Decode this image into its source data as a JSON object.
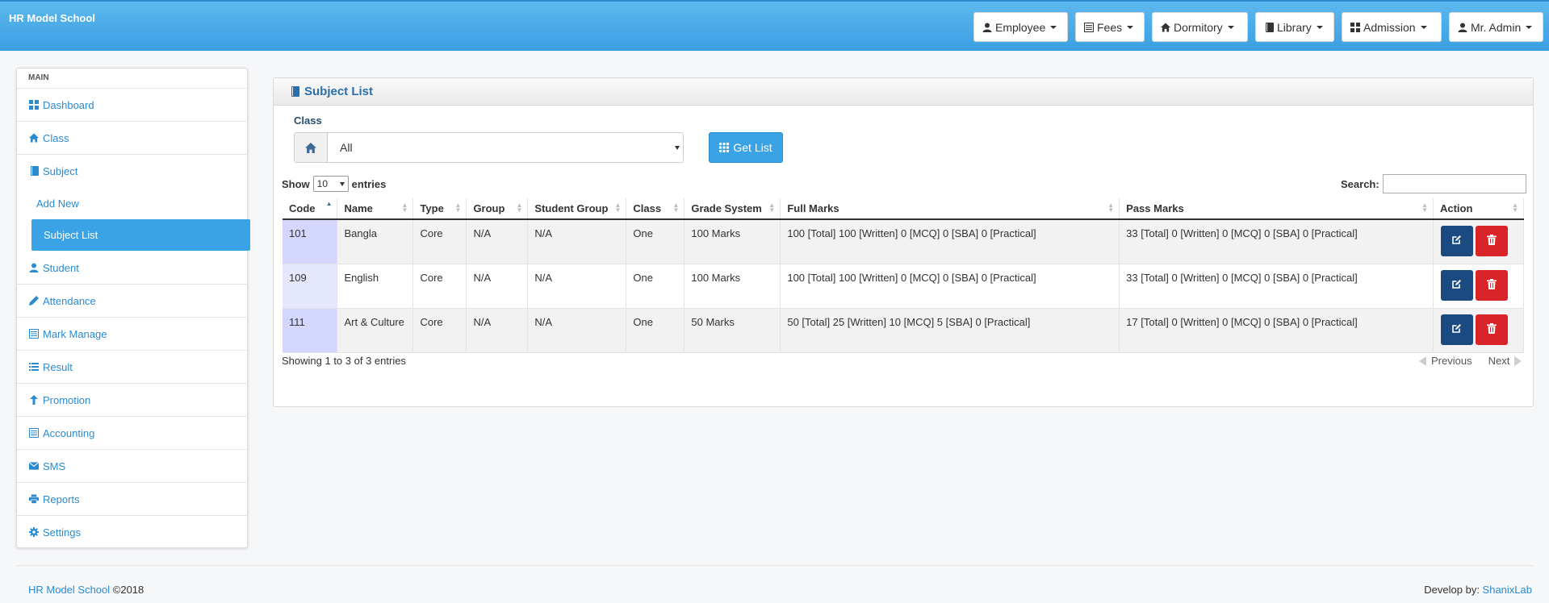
{
  "app": {
    "title": "HR Model School"
  },
  "nav": {
    "employee": "Employee",
    "fees": "Fees",
    "dormitory": "Dormitory",
    "library": "Library",
    "admission": "Admission",
    "user": "Mr. Admin"
  },
  "sidebar": {
    "header": "MAIN",
    "dashboard": "Dashboard",
    "class": "Class",
    "subject": "Subject",
    "add_new": "Add New",
    "subject_list": "Subject List",
    "student": "Student",
    "attendance": "Attendance",
    "mark_manage": "Mark Manage",
    "result": "Result",
    "promotion": "Promotion",
    "accounting": "Accounting",
    "sms": "SMS",
    "reports": "Reports",
    "settings": "Settings"
  },
  "panel": {
    "title": "Subject List",
    "class_label": "Class",
    "class_value": "All",
    "get_list": "Get List",
    "show_label": "Show",
    "show_value": "10",
    "entries_label": "entries",
    "search_label": "Search:"
  },
  "table": {
    "headers": [
      "Code",
      "Name",
      "Type",
      "Group",
      "Student Group",
      "Class",
      "Grade System",
      "Full Marks",
      "Pass Marks",
      "Action"
    ],
    "rows": [
      {
        "code": "101",
        "name": "Bangla",
        "type": "Core",
        "group": "N/A",
        "student_group": "N/A",
        "class": "One",
        "grade": "100 Marks",
        "full": "100 [Total] 100 [Written] 0 [MCQ] 0 [SBA] 0 [Practical]",
        "pass": "33 [Total] 0 [Written] 0 [MCQ] 0 [SBA] 0 [Practical]"
      },
      {
        "code": "109",
        "name": "English",
        "type": "Core",
        "group": "N/A",
        "student_group": "N/A",
        "class": "One",
        "grade": "100 Marks",
        "full": "100 [Total] 100 [Written] 0 [MCQ] 0 [SBA] 0 [Practical]",
        "pass": "33 [Total] 0 [Written] 0 [MCQ] 0 [SBA] 0 [Practical]"
      },
      {
        "code": "111",
        "name": "Art & Culture",
        "type": "Core",
        "group": "N/A",
        "student_group": "N/A",
        "class": "One",
        "grade": "50 Marks",
        "full": "50 [Total] 25 [Written] 10 [MCQ] 5 [SBA] 0 [Practical]",
        "pass": "17 [Total] 0 [Written] 0 [MCQ] 0 [SBA] 0 [Practical]"
      }
    ],
    "info": "Showing 1 to 3 of 3 entries",
    "previous": "Previous",
    "next": "Next"
  },
  "footer": {
    "school_link": "HR Model School",
    "copyright": " ©2018",
    "develop_by": "Develop by: ",
    "dev_link": "ShanixLab"
  },
  "colors": {
    "primary": "#3aa3e6",
    "edit": "#1a4a80",
    "delete": "#d9252a"
  }
}
